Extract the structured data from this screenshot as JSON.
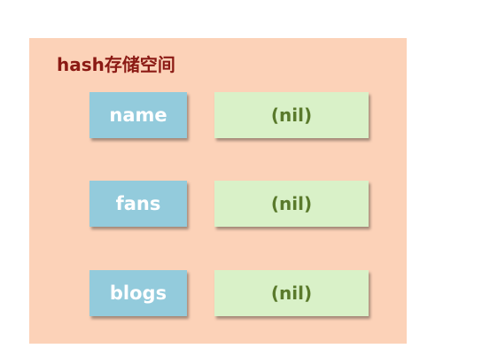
{
  "panel": {
    "title": "hash存储空间",
    "rows": [
      {
        "key": "name",
        "value": "(nil)"
      },
      {
        "key": "fans",
        "value": "(nil)"
      },
      {
        "key": "blogs",
        "value": "(nil)"
      }
    ]
  },
  "colors": {
    "panel_bg": "#fcd2b8",
    "title_text": "#8b1a14",
    "key_box": "#93cbdc",
    "value_box": "#d9f1c8",
    "value_text": "#5a7a2c"
  }
}
